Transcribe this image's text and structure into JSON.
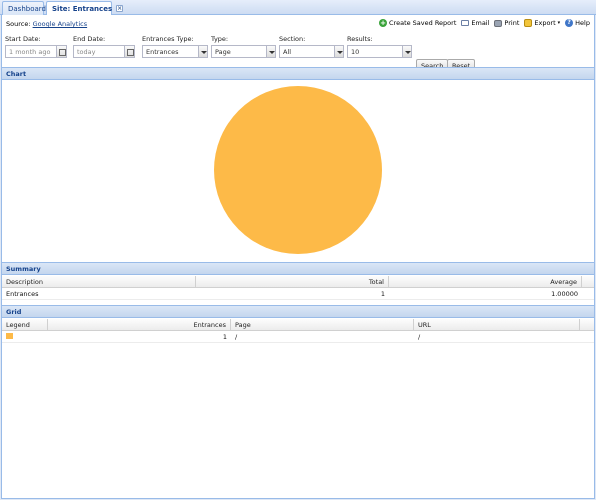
{
  "tabs": [
    {
      "label": "Dashboard"
    },
    {
      "label": "Site: Entrances",
      "close": "×"
    }
  ],
  "source": {
    "prefix": "Source:",
    "link": "Google Analytics"
  },
  "toolbar": {
    "create_saved_report": "Create Saved Report",
    "email": "Email",
    "print": "Print",
    "export": "Export",
    "help": "Help"
  },
  "filters": {
    "start_date": {
      "label": "Start Date:",
      "value": "1 month ago"
    },
    "end_date": {
      "label": "End Date:",
      "value": "today"
    },
    "entrances_type": {
      "label": "Entrances Type:",
      "value": "Entrances"
    },
    "type": {
      "label": "Type:",
      "value": "Page"
    },
    "section": {
      "label": "Section:",
      "value": "All"
    },
    "results": {
      "label": "Results:",
      "value": "10"
    },
    "search_button": "Search",
    "reset_button": "Reset"
  },
  "chart_section": {
    "title": "Chart"
  },
  "chart_data": {
    "type": "pie",
    "categories": [
      "/"
    ],
    "values": [
      1
    ],
    "colors": [
      "#fdba48"
    ]
  },
  "summary": {
    "title": "Summary",
    "headers": [
      "Description",
      "Total",
      "Average"
    ],
    "rows": [
      [
        "Entrances",
        "1",
        "1.00000"
      ]
    ]
  },
  "grid": {
    "title": "Grid",
    "headers": [
      "Legend",
      "Entrances",
      "Page",
      "URL"
    ],
    "rows": [
      {
        "color": "#fdba48",
        "entrances": "1",
        "page": "/",
        "url": "/"
      }
    ]
  }
}
